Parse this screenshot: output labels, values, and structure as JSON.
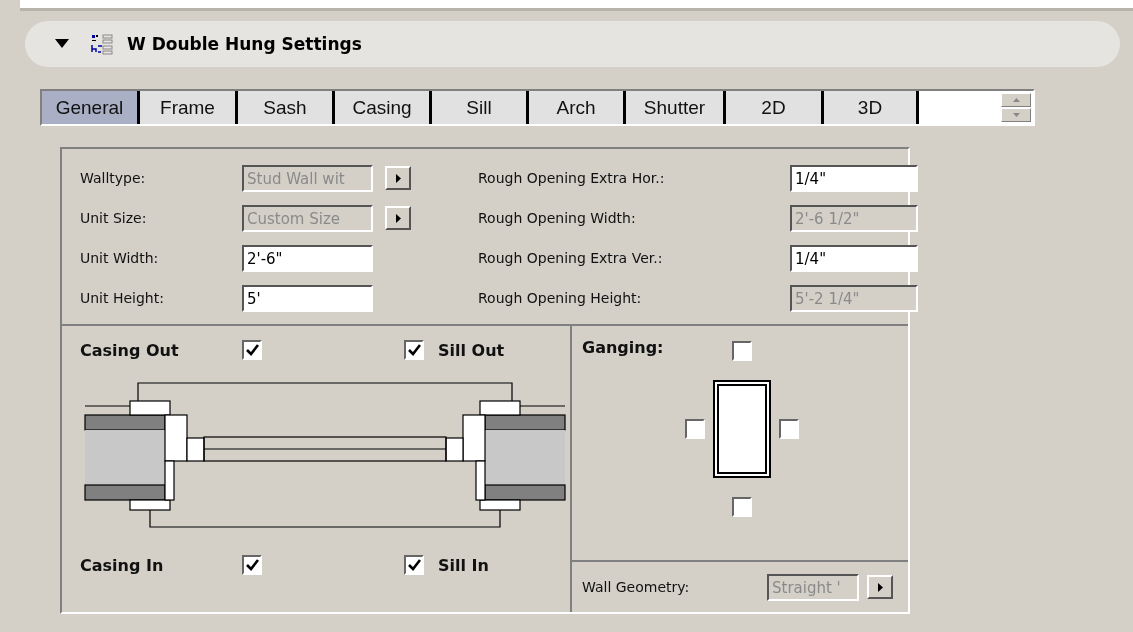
{
  "header": {
    "title": "W Double Hung Settings",
    "expanded": true
  },
  "tabs": [
    {
      "label": "General",
      "selected": true
    },
    {
      "label": "Frame",
      "selected": false
    },
    {
      "label": "Sash",
      "selected": false
    },
    {
      "label": "Casing",
      "selected": false
    },
    {
      "label": "Sill",
      "selected": false
    },
    {
      "label": "Arch",
      "selected": false
    },
    {
      "label": "Shutter",
      "selected": false
    },
    {
      "label": "2D",
      "selected": false
    },
    {
      "label": "3D",
      "selected": false
    }
  ],
  "fields_left": [
    {
      "label": "Walltype:",
      "value": "Stud Wall wit",
      "disabled": true,
      "kind": "dropdown"
    },
    {
      "label": "Unit Size:",
      "value": "Custom Size",
      "disabled": true,
      "kind": "dropdown"
    },
    {
      "label": "Unit Width:",
      "value": "2'-6\"",
      "disabled": false,
      "kind": "input"
    },
    {
      "label": "Unit Height:",
      "value": "5'",
      "disabled": false,
      "kind": "input"
    }
  ],
  "fields_right": [
    {
      "label": "Rough Opening Extra Hor.:",
      "value": "1/4\"",
      "disabled": false
    },
    {
      "label": "Rough Opening Width:",
      "value": "2'-6 1/2\"",
      "disabled": true
    },
    {
      "label": "Rough Opening Extra Ver.:",
      "value": "1/4\"",
      "disabled": false
    },
    {
      "label": "Rough Opening Height:",
      "value": "5'-2 1/4\"",
      "disabled": true
    }
  ],
  "casing_options": [
    {
      "label": "Casing Out",
      "checked": true
    },
    {
      "label": "Sill Out",
      "checked": true
    },
    {
      "label": "Casing In",
      "checked": true
    },
    {
      "label": "Sill In",
      "checked": true
    }
  ],
  "ganging": {
    "label": "Ganging:",
    "top": false,
    "left": false,
    "right": false,
    "bottom": false
  },
  "wall_geometry": {
    "label": "Wall Geometry:",
    "value": "Straight '",
    "disabled": true
  }
}
